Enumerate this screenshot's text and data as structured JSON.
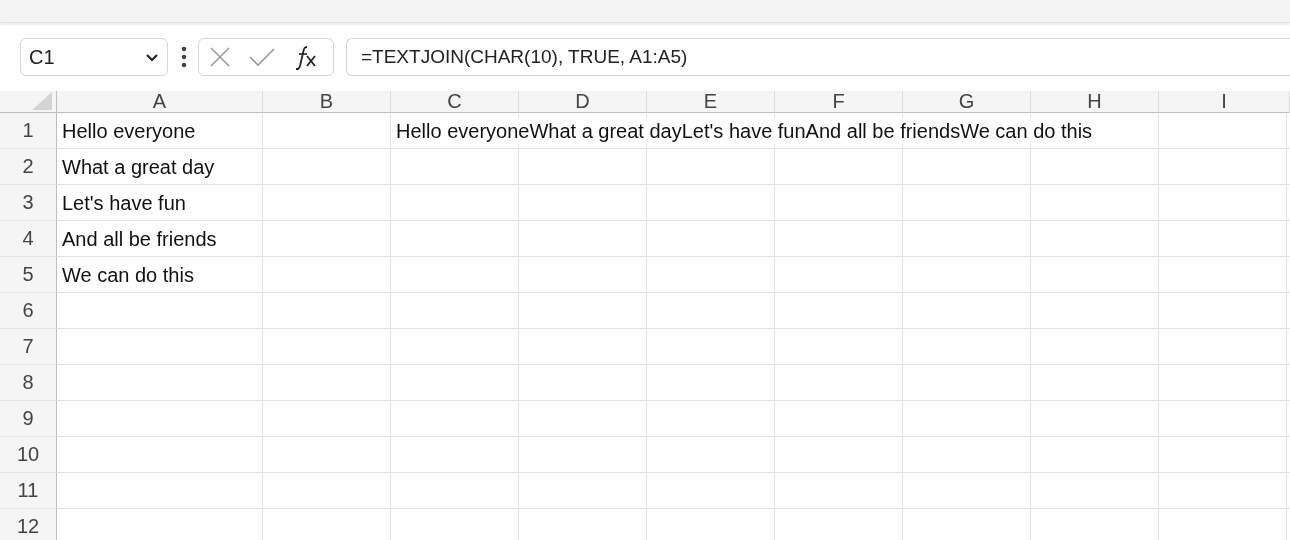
{
  "formula_bar": {
    "name_box": "C1",
    "formula": "=TEXTJOIN(CHAR(10), TRUE, A1:A5)"
  },
  "columns": [
    "A",
    "B",
    "C",
    "D",
    "E",
    "F",
    "G",
    "H",
    "I"
  ],
  "rows": [
    {
      "header": "1",
      "column_a": "Hello everyone",
      "column_c": "Hello everyoneWhat a great dayLet's have funAnd all be friendsWe can do this"
    },
    {
      "header": "2",
      "column_a": "What a great day"
    },
    {
      "header": "3",
      "column_a": "Let's have fun"
    },
    {
      "header": "4",
      "column_a": "And all be friends"
    },
    {
      "header": "5",
      "column_a": "We can do this"
    },
    {
      "header": "6"
    },
    {
      "header": "7"
    },
    {
      "header": "8"
    },
    {
      "header": "9"
    },
    {
      "header": "10"
    },
    {
      "header": "11"
    },
    {
      "header": "12"
    }
  ]
}
